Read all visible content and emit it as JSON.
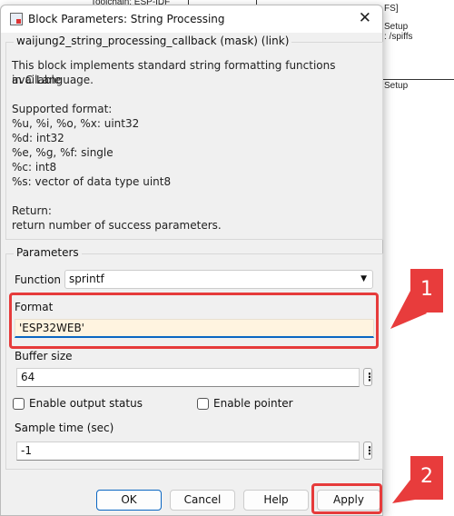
{
  "background": {
    "text1": "Toolchain: ESP-IDF",
    "text2": "FS]",
    "text3": "Setup",
    "text4": ": /spiffs",
    "text5": "Setup"
  },
  "dialog": {
    "title": "Block Parameters: String Processing",
    "mask_title": "waijung2_string_processing_callback (mask) (link)",
    "description": [
      "This block implements standard string formatting functions available",
      "in C Language.",
      "",
      "Supported format:",
      "%u, %i, %o, %x: uint32",
      "%d: int32",
      "%e, %g, %f: single",
      "%c: int8",
      "%s: vector of data type uint8",
      "",
      "Return:",
      "return number of success parameters."
    ],
    "parameters_label": "Parameters",
    "function_label": "Function",
    "function_value": "sprintf",
    "format_label": "Format",
    "format_value": "'ESP32WEB'",
    "buffer_label": "Buffer size",
    "buffer_value": "64",
    "enable_output_status": {
      "label": "Enable output status",
      "checked": false
    },
    "enable_pointer": {
      "label": "Enable pointer",
      "checked": false
    },
    "sample_time_label": "Sample time (sec)",
    "sample_time_value": "-1",
    "buttons": {
      "ok": "OK",
      "cancel": "Cancel",
      "help": "Help",
      "apply": "Apply"
    }
  },
  "annotations": {
    "callout1": "1",
    "callout2": "2",
    "color": "#e83c3c"
  }
}
